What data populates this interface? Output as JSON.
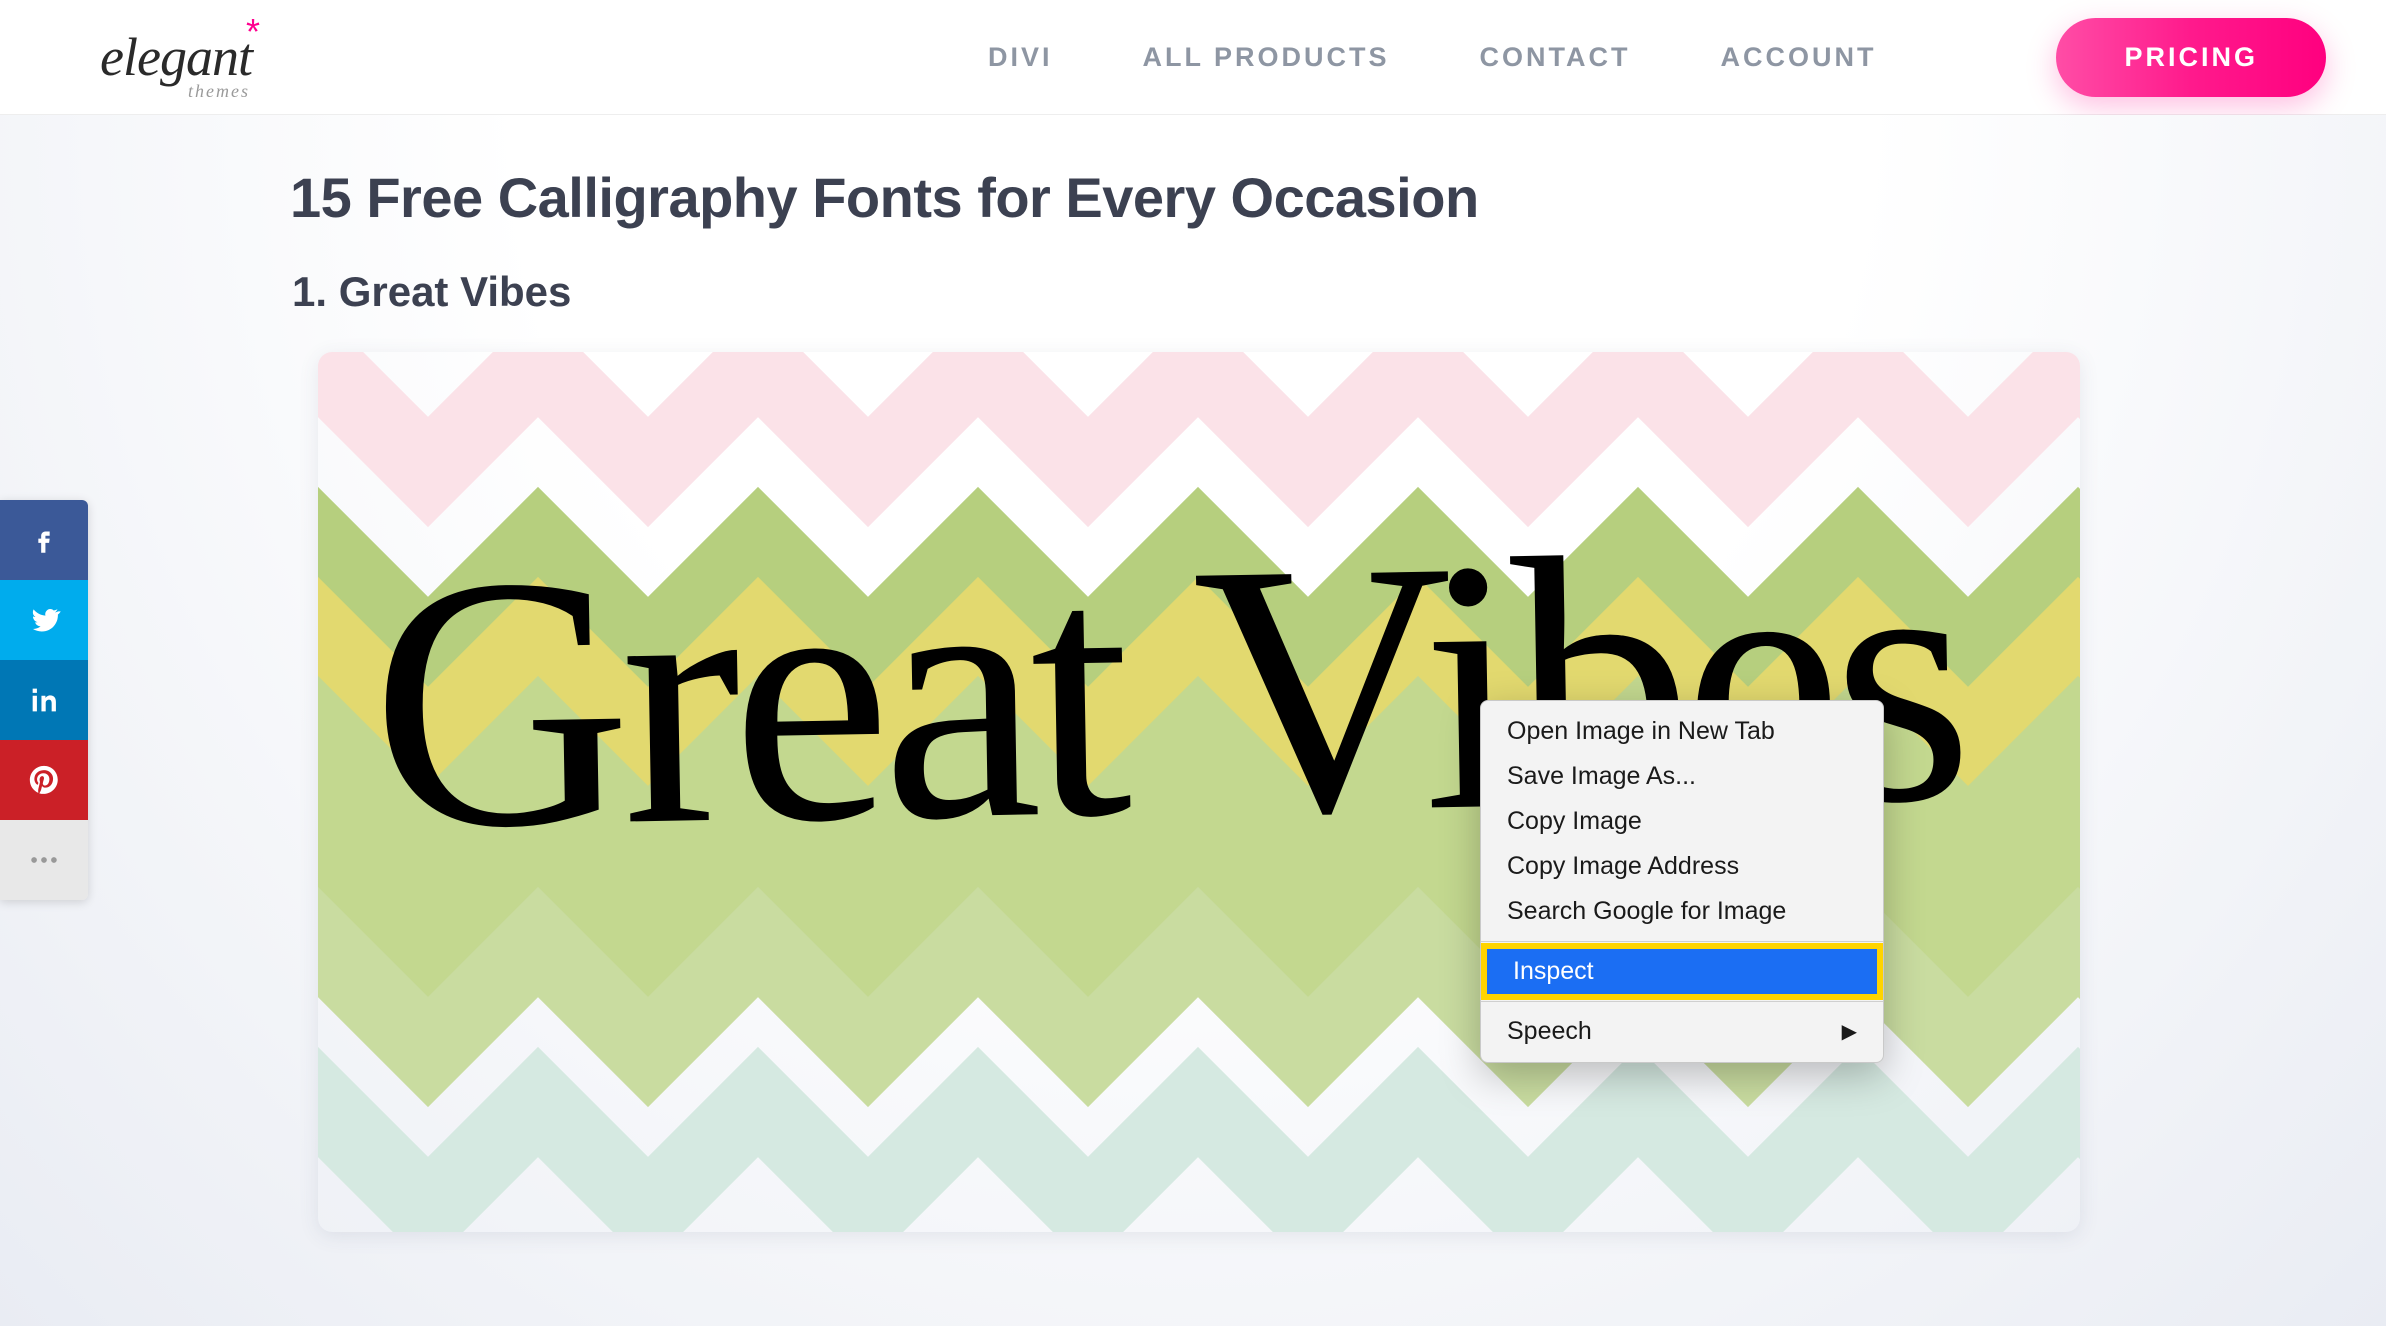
{
  "brand": {
    "name": "elegant",
    "sub": "themes",
    "star": "*"
  },
  "nav": {
    "items": [
      "DIVI",
      "ALL PRODUCTS",
      "CONTACT",
      "ACCOUNT"
    ],
    "pricing": "PRICING"
  },
  "article": {
    "title": "15 Free Calligraphy Fonts for Every Occasion",
    "section_heading": "1. Great Vibes",
    "sample_text": "Great Vibes"
  },
  "context_menu": {
    "items": [
      "Open Image in New Tab",
      "Save Image As...",
      "Copy Image",
      "Copy Image Address",
      "Search Google for Image"
    ],
    "highlighted": "Inspect",
    "submenu": "Speech"
  },
  "share": {
    "facebook": "facebook-icon",
    "twitter": "twitter-icon",
    "linkedin": "linkedin-icon",
    "pinterest": "pinterest-icon",
    "more": "more-icon"
  }
}
